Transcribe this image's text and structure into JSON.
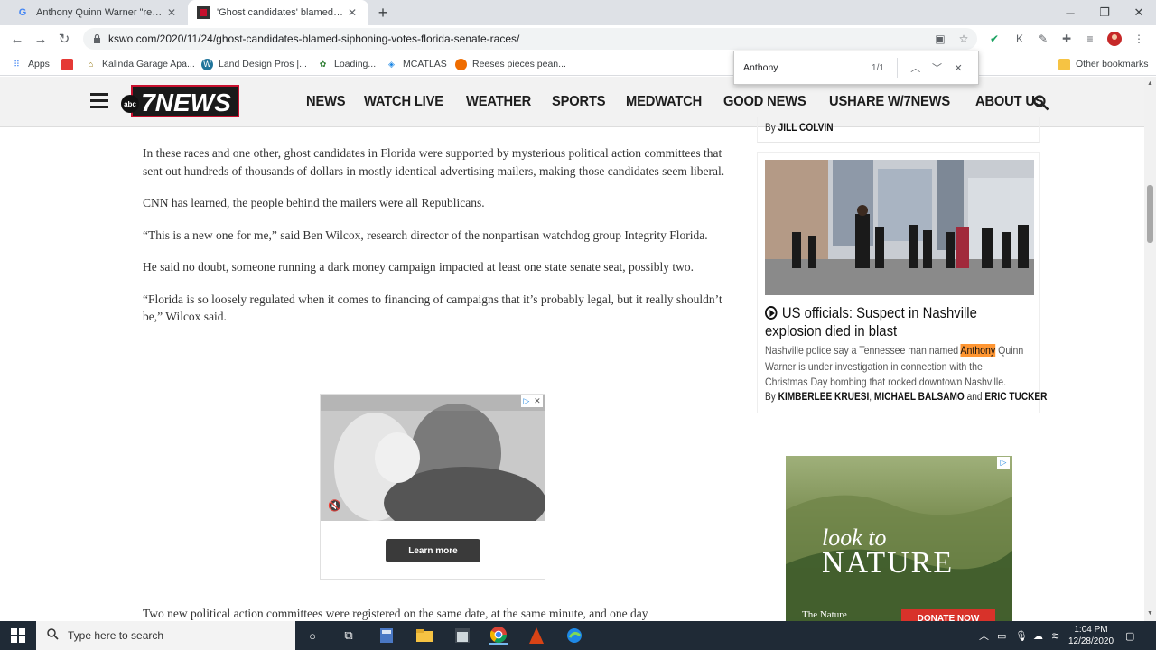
{
  "browser": {
    "tabs": [
      {
        "title": "Anthony Quinn Warner \"registere...",
        "active": false
      },
      {
        "title": "'Ghost candidates' blamed for sip...",
        "active": true
      }
    ],
    "url": "kswo.com/2020/11/24/ghost-candidates-blamed-siphoning-votes-florida-senate-races/",
    "bookmarks": [
      "Apps",
      "Kalinda Garage Apa...",
      "Land Design Pros |...",
      "Loading...",
      "MCATLAS",
      "Reeses pieces pean..."
    ],
    "other_bookmarks": "Other bookmarks"
  },
  "findbar": {
    "query": "Anthony",
    "count": "1/1"
  },
  "site": {
    "logo_text": "7NEWS",
    "logo_small": "abc",
    "nav": [
      "NEWS",
      "WATCH LIVE",
      "WEATHER",
      "SPORTS",
      "MEDWATCH",
      "GOOD NEWS",
      "USHARE W/7NEWS",
      "ABOUT US"
    ]
  },
  "article": {
    "paragraphs": [
      "In these races and one other, ghost candidates in Florida were supported by mysterious political action committees that sent out hundreds of thousands of dollars in mostly identical advertising mailers, making those candidates seem liberal.",
      "CNN has learned, the people behind the mailers were all Republicans.",
      "“This is a new one for me,” said Ben Wilcox, research director of the nonpartisan watchdog group Integrity Florida.",
      "He said no doubt, someone running a dark money campaign impacted at least one state senate seat, possibly two.",
      "“Florida is so loosely regulated when it comes to financing of campaigns that it’s probably legal, but it really shouldn’t be,” Wilcox said."
    ],
    "bottom_line": "Two new political action committees were registered on the same date, at the same minute, and one day",
    "ad_button": "Learn more"
  },
  "sidebar": {
    "top_byline_prefix": "By",
    "top_byline_author": "JILL COLVIN",
    "story": {
      "headline": "US officials: Suspect in Nashville explosion died in blast",
      "summary_before": "Nashville police say a Tennessee man named",
      "summary_highlight": "Anthony",
      "summary_after": "Quinn Warner is under investigation in connection with the Christmas Day bombing that rocked downtown Nashville.",
      "byline_prefix": "By",
      "author1": "KIMBERLEE KRUESI",
      "sep1": ",",
      "author2": "MICHAEL BALSAMO",
      "sep2": "and",
      "author3": "ERIC TUCKER"
    },
    "ad": {
      "line1": "look to",
      "line2": "NATURE",
      "org": "The Nature",
      "button": "DONATE NOW"
    }
  },
  "taskbar": {
    "search_placeholder": "Type here to search",
    "time": "1:04 PM",
    "date": "12/28/2020"
  },
  "colors": {
    "highlight": "#ff9632",
    "taskbar": "#1f2a36",
    "logo_red": "#c8102e"
  }
}
